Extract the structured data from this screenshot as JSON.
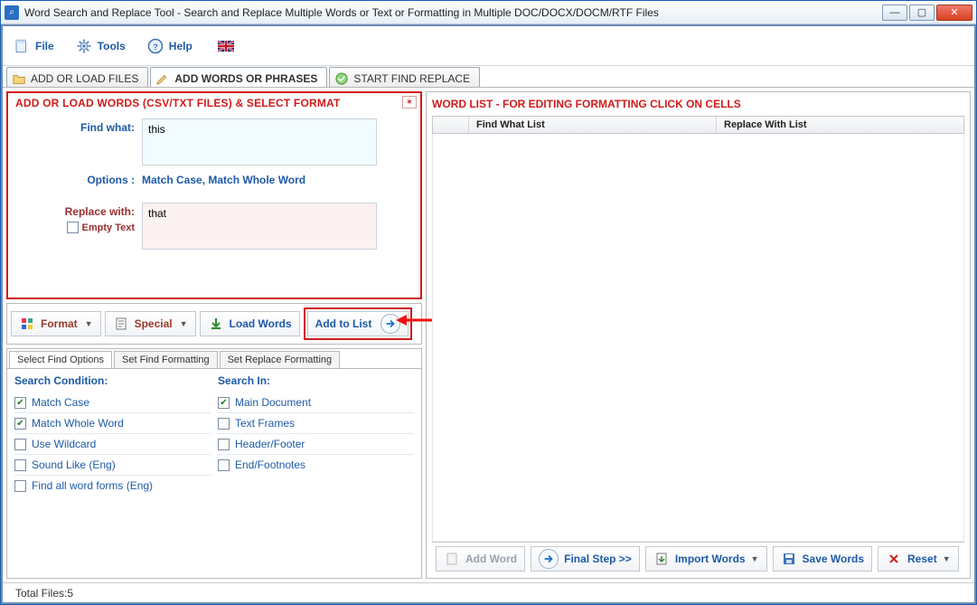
{
  "titlebar": {
    "title": "Word Search and Replace Tool - Search and Replace Multiple Words or Text  or Formatting in Multiple DOC/DOCX/DOCM/RTF Files"
  },
  "menu": {
    "file": "File",
    "tools": "Tools",
    "help": "Help"
  },
  "tabs": {
    "add_files": "ADD OR LOAD FILES",
    "add_words": "ADD WORDS OR PHRASES",
    "start": "START FIND REPLACE"
  },
  "left_panel": {
    "title": "ADD OR LOAD WORDS (CSV/TXT FILES) & SELECT FORMAT",
    "find_label": "Find what:",
    "find_value": "this",
    "options_label": "Options :",
    "options_value": "Match Case, Match Whole Word",
    "replace_label": "Replace with:",
    "replace_value": "that",
    "empty_text_label": "Empty Text"
  },
  "toolbar2": {
    "format": "Format",
    "special": "Special",
    "load_words": "Load Words",
    "add_to_list": "Add to List"
  },
  "opt_tabs": {
    "select": "Select Find Options",
    "set_find": "Set Find Formatting",
    "set_replace": "Set Replace Formatting"
  },
  "search_condition": {
    "heading": "Search Condition:",
    "match_case": "Match Case",
    "match_whole": "Match Whole Word",
    "wildcard": "Use Wildcard",
    "sound_like": "Sound Like (Eng)",
    "all_forms": "Find all word forms (Eng)"
  },
  "search_in": {
    "heading": "Search In:",
    "main_doc": "Main Document",
    "text_frames": "Text Frames",
    "header_footer": "Header/Footer",
    "end_footnotes": "End/Footnotes"
  },
  "right_panel": {
    "title": "WORD LIST - FOR EDITING FORMATTING CLICK ON CELLS",
    "col1": "Find What List",
    "col2": "Replace With List"
  },
  "bottom": {
    "add_word": "Add Word",
    "final_step": "Final Step >>",
    "import_words": "Import Words",
    "save_words": "Save Words",
    "reset": "Reset"
  },
  "status": {
    "text": "Total Files:5"
  }
}
